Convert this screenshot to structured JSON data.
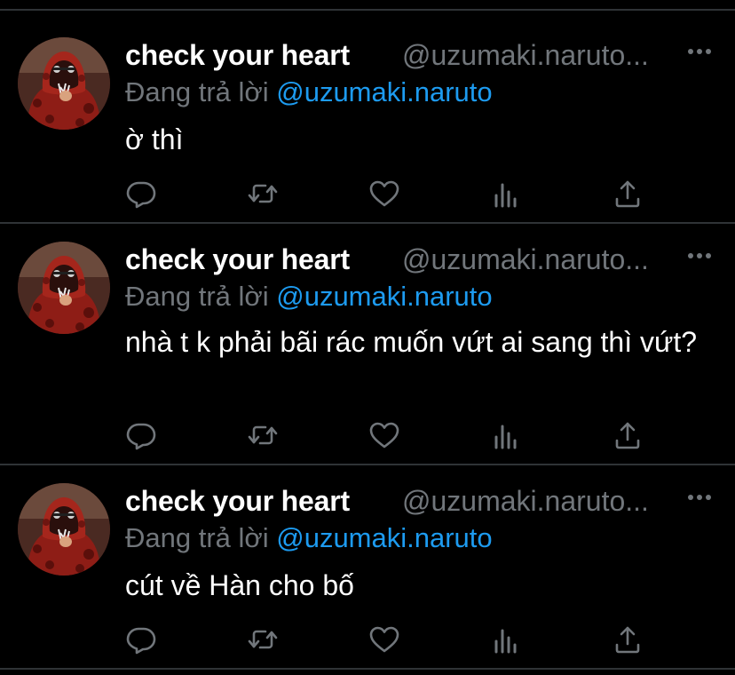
{
  "colors": {
    "background": "#000000",
    "separator": "#2f3336",
    "muted": "#71767b",
    "mention": "#1d9bf0",
    "text": "#ffffff"
  },
  "tweets": [
    {
      "display_name": "check your heart",
      "handle": "@uzumaki.naruto...",
      "reply_prefix": "Đang trả lời ",
      "reply_mention": "@uzumaki.naruto",
      "text": "ờ thì",
      "avatar_icon": "avatar-red-hoodie",
      "actions": [
        "reply-icon",
        "retweet-icon",
        "like-icon",
        "views-icon",
        "share-icon"
      ]
    },
    {
      "display_name": "check your heart",
      "handle": "@uzumaki.naruto...",
      "reply_prefix": "Đang trả lời ",
      "reply_mention": "@uzumaki.naruto",
      "text": "nhà t k phải bãi rác muốn vứt ai sang thì vứt?",
      "avatar_icon": "avatar-red-hoodie",
      "actions": [
        "reply-icon",
        "retweet-icon",
        "like-icon",
        "views-icon",
        "share-icon"
      ]
    },
    {
      "display_name": "check your heart",
      "handle": "@uzumaki.naruto...",
      "reply_prefix": "Đang trả lời ",
      "reply_mention": "@uzumaki.naruto",
      "text": "cút về Hàn cho bố",
      "avatar_icon": "avatar-red-hoodie",
      "actions": [
        "reply-icon",
        "retweet-icon",
        "like-icon",
        "views-icon",
        "share-icon"
      ]
    }
  ]
}
